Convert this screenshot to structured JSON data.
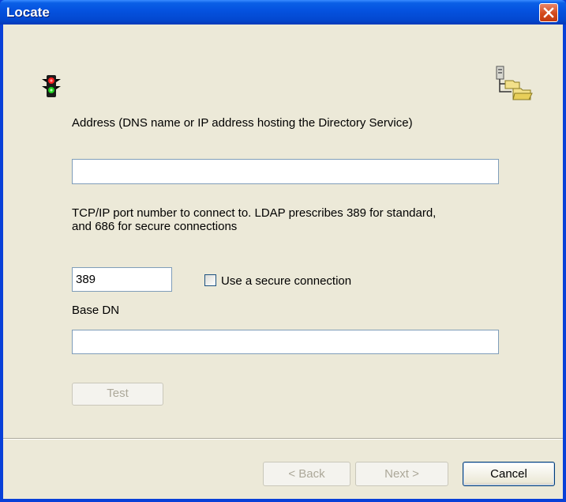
{
  "window": {
    "title": "Locate"
  },
  "address": {
    "label": "Address (DNS name or IP address hosting the Directory Service)",
    "value": ""
  },
  "port": {
    "label": "TCP/IP port number to connect to. LDAP prescribes 389 for standard,\nand 686 for secure connections",
    "value": "389"
  },
  "secure": {
    "label": "Use a secure connection",
    "checked": false
  },
  "base_dn": {
    "label": "Base DN",
    "value": ""
  },
  "buttons": {
    "test": "Test",
    "back": "< Back",
    "next": "Next >",
    "cancel": "Cancel"
  },
  "icons": {
    "status": "traffic-light-icon",
    "directory": "directory-tree-icon"
  },
  "colors": {
    "titlebar": "#0553e0",
    "client_bg": "#ece9d8",
    "close_button": "#d44a1c",
    "disabled_text": "#aca899"
  }
}
